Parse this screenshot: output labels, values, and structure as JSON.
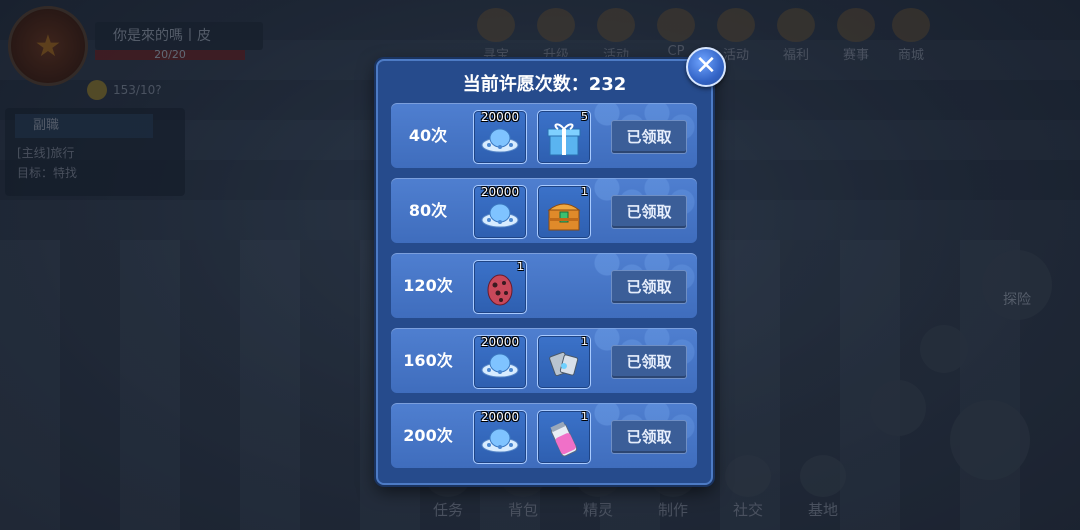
{
  "player": {
    "name": "你是來的嗎丨皮",
    "hp": "20/20",
    "coins": "153/10?"
  },
  "quest": {
    "title": "副職",
    "line1": "[主线]旅行",
    "line2": "目标：特找"
  },
  "top_menu": [
    "寻宝",
    "升级",
    "活动",
    "CP",
    "活动",
    "福利",
    "赛事",
    "商城"
  ],
  "bottom_menu": [
    "任务",
    "背包",
    "精灵",
    "制作",
    "社交",
    "基地"
  ],
  "side_buttons": {
    "explore": "探险"
  },
  "dialog": {
    "title": "当前许愿次数：232",
    "claimed_label": "已领取",
    "rows": [
      {
        "count": "40次",
        "items": [
          {
            "icon": "ufo-currency-icon",
            "qty": "20000"
          },
          {
            "icon": "blue-gift-box-icon",
            "qty": "5"
          }
        ]
      },
      {
        "count": "80次",
        "items": [
          {
            "icon": "ufo-currency-icon",
            "qty": "20000"
          },
          {
            "icon": "treasure-chest-icon",
            "qty": "1"
          }
        ]
      },
      {
        "count": "120次",
        "items": [
          {
            "icon": "spotted-egg-icon",
            "qty": "1"
          }
        ]
      },
      {
        "count": "160次",
        "items": [
          {
            "icon": "ufo-currency-icon",
            "qty": "20000"
          },
          {
            "icon": "metal-part-icon",
            "qty": "1"
          }
        ]
      },
      {
        "count": "200次",
        "items": [
          {
            "icon": "ufo-currency-icon",
            "qty": "20000"
          },
          {
            "icon": "potion-vial-icon",
            "qty": "1"
          }
        ]
      }
    ]
  }
}
